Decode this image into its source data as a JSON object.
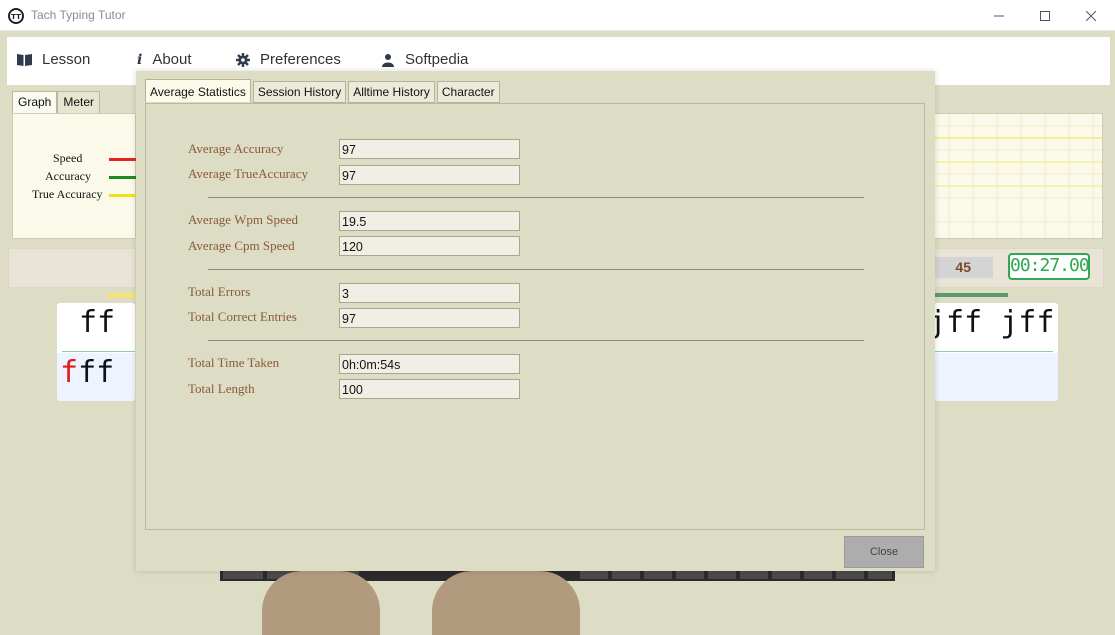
{
  "window": {
    "title": "Tach Typing Tutor"
  },
  "menu": {
    "lesson": "Lesson",
    "about": "About",
    "preferences": "Preferences",
    "softpedia": "Softpedia"
  },
  "graph_panel": {
    "tabs": [
      "Graph",
      "Meter"
    ],
    "legend": [
      {
        "label": "Speed",
        "color": "#e8231f"
      },
      {
        "label": "Accuracy",
        "color": "#1f8b1f"
      },
      {
        "label": "True Accuracy",
        "color": "#f2e21a"
      }
    ]
  },
  "status": {
    "count": "45",
    "timer": "00:27.00"
  },
  "typing": {
    "left_target": "ff",
    "left_typed_error": "f",
    "left_typed_rest": "ff",
    "right_target": "jff jff"
  },
  "dialog": {
    "tabs": [
      "Average Statistics",
      "Session History",
      "Alltime History",
      "Character"
    ],
    "stats": {
      "avg_accuracy_label": "Average Accuracy",
      "avg_accuracy": "97",
      "avg_true_accuracy_label": "Average TrueAccuracy",
      "avg_true_accuracy": "97",
      "avg_wpm_label": "Average Wpm Speed",
      "avg_wpm": "19.5",
      "avg_cpm_label": "Average Cpm Speed",
      "avg_cpm": "120",
      "total_errors_label": "Total Errors",
      "total_errors": "3",
      "total_correct_label": "Total Correct Entries",
      "total_correct": "97",
      "total_time_label": "Total Time Taken",
      "total_time": "0h:0m:54s",
      "total_length_label": "Total Length",
      "total_length": "100"
    },
    "close_label": "Close"
  }
}
